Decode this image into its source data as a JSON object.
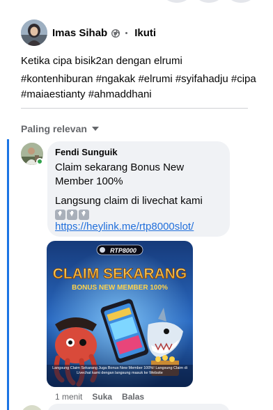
{
  "post": {
    "author": "Imas Sihab",
    "privacy_icon": "globe-icon",
    "follow_label": "Ikuti",
    "text": "Ketika cipa bisik2an dengan elrumi",
    "hashtags": "#kontenhiburan #ngakak #elrumi #syifahadju #cipa #maiaestianty #ahmaddhani"
  },
  "comments_sort": {
    "label": "Paling relevan",
    "icon": "caret-down-icon"
  },
  "comment": {
    "author": "Fendi Sunguik",
    "line1": "Claim sekarang Bonus New Member 100%",
    "line2": "Langsung claim di livechat kami",
    "emojis": [
      "down-arrow-emoji",
      "down-arrow-emoji",
      "down-arrow-emoji"
    ],
    "link": "https://heylink.me/rtp8000slot/",
    "image": {
      "logo": "RTP8000",
      "headline": "CLAIM SEKARANG",
      "subhead": "BONUS NEW MEMBER 100%",
      "caption": "Langsung Claim Sekarang Juga Bonus New Member 100%! Langsung Claim di Livechat kami dengan langsung masuk ke Website"
    },
    "time": "1 menit",
    "like_label": "Suka",
    "reply_label": "Balas",
    "online": true
  },
  "colors": {
    "link": "#216fdb",
    "focus_bar": "#1b74e4",
    "online": "#31a24c",
    "bubble": "#f0f2f5"
  }
}
